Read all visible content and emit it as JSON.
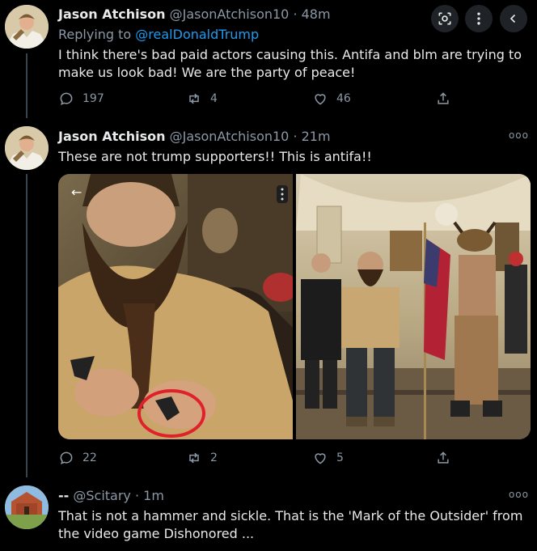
{
  "top_controls": {
    "icons": [
      "lens-icon",
      "more-vertical-icon",
      "back-icon"
    ]
  },
  "tweets": [
    {
      "name": "Jason Atchison",
      "handle": "@JasonAtchison10",
      "time": "· 48m",
      "replying_prefix": "Replying to ",
      "replying_to": "@realDonaldTrump",
      "text": "I think there's bad paid actors causing this. Antifa and blm are trying to make us look bad! We are the party of peace!",
      "replies": "197",
      "retweets": "4",
      "likes": "46"
    },
    {
      "name": "Jason Atchison",
      "handle": "@JasonAtchison10",
      "time": "· 21m",
      "text": "These are not trump supporters!! This is antifa!!",
      "replies": "22",
      "retweets": "2",
      "likes": "5"
    },
    {
      "name": "--",
      "handle": "@Scitary",
      "time": "· 1m",
      "text": "That is not a hammer and sickle. That is the 'Mark of the Outsider' from the video game Dishonored ..."
    }
  ],
  "colors": {
    "background": "#000000",
    "text": "#e7e9ea",
    "muted": "#8b98a5",
    "link": "#1d9bf0",
    "circle_annotation": "#e0202a"
  }
}
